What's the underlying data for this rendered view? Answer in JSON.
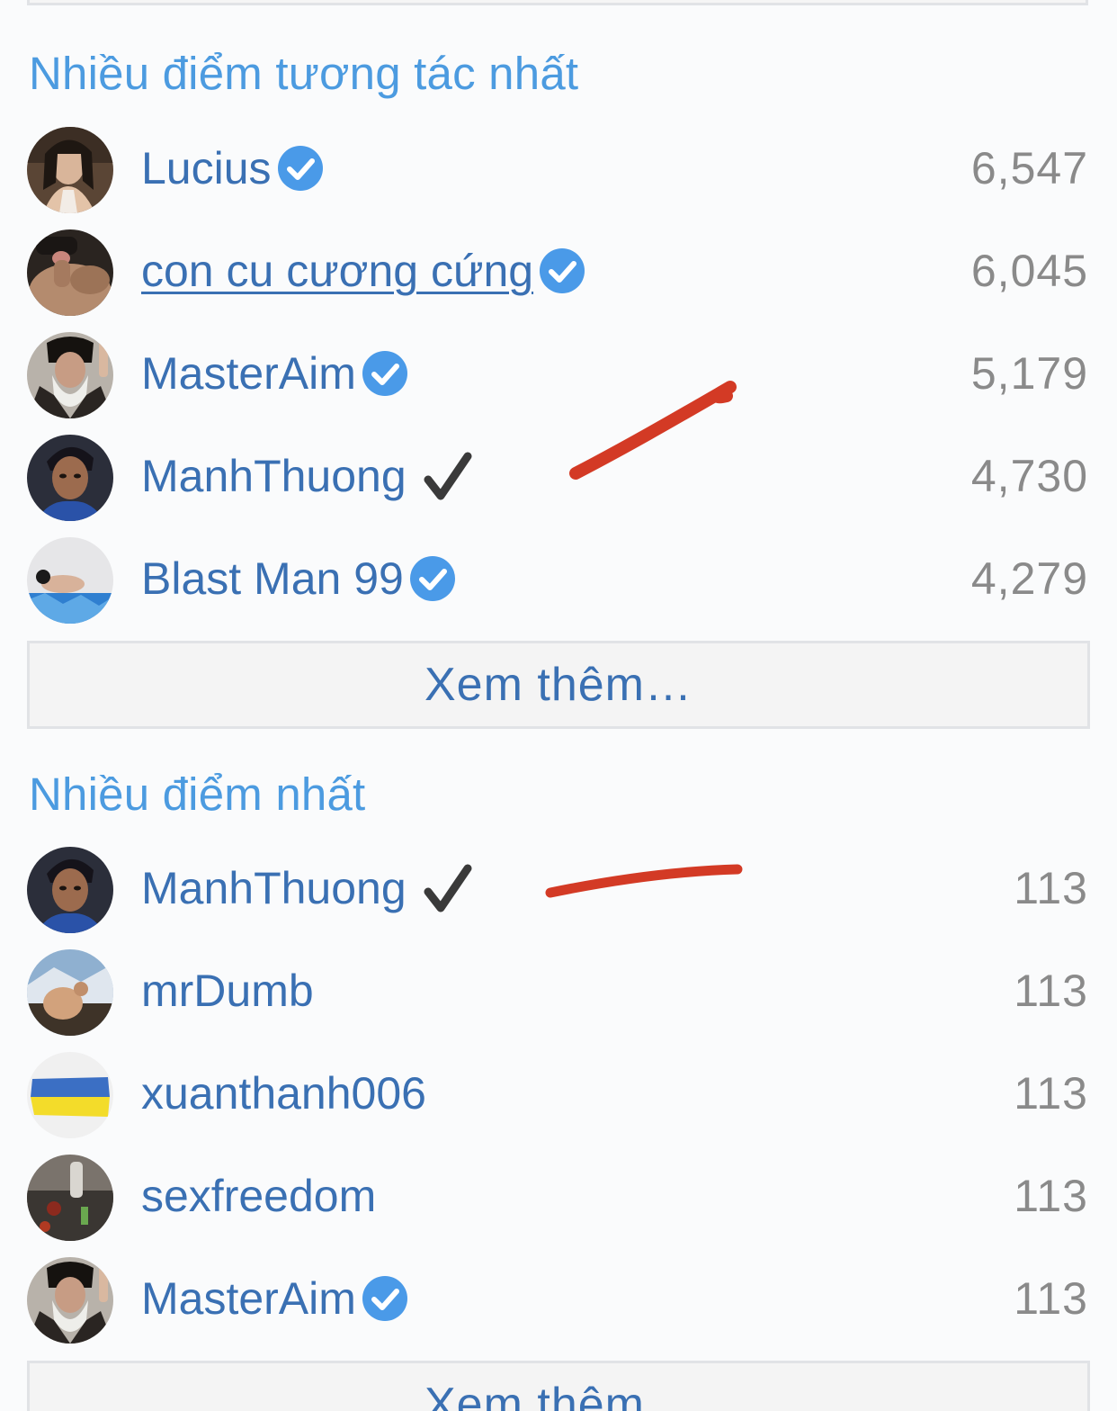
{
  "section_interactions": {
    "title": "Nhiều điểm tương tác nhất",
    "rows": [
      {
        "name": "Lucius",
        "score": "6,547",
        "badge": "verified-badge-icon"
      },
      {
        "name": "con cu cương cứng",
        "score": "6,045",
        "badge": "verified-badge-icon"
      },
      {
        "name": "MasterAim",
        "score": "5,179",
        "badge": "verified-badge-icon"
      },
      {
        "name": "ManhThuong",
        "score": "4,730",
        "badge": "checkmark-icon"
      },
      {
        "name": "Blast Man 99",
        "score": "4,279",
        "badge": "verified-badge-icon"
      }
    ],
    "more_label": "Xem thêm…"
  },
  "section_points": {
    "title": "Nhiều điểm nhất",
    "rows": [
      {
        "name": "ManhThuong",
        "score": "113",
        "badge": "checkmark-icon"
      },
      {
        "name": "mrDumb",
        "score": "113",
        "badge": ""
      },
      {
        "name": "xuanthanh006",
        "score": "113",
        "badge": ""
      },
      {
        "name": "sexfreedom",
        "score": "113",
        "badge": ""
      },
      {
        "name": "MasterAim",
        "score": "113",
        "badge": "verified-badge-icon"
      }
    ],
    "more_label": "Xem thêm…"
  },
  "colors": {
    "section_title": "#4c9be0",
    "username": "#3a70b3",
    "score": "#8a8a8a",
    "verified_badge": "#4a9ae8",
    "annotation_stroke": "#d33a25"
  }
}
